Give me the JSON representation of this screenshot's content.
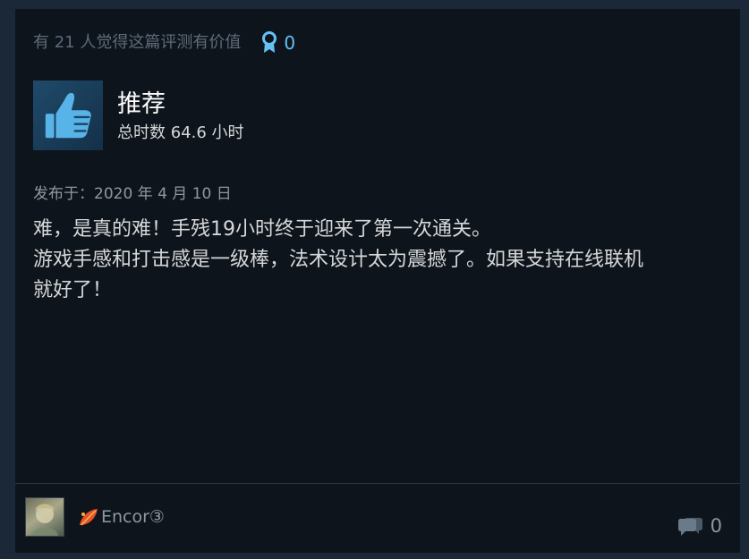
{
  "review": {
    "helpful_text": "有 21 人觉得这篇评测有价值",
    "award_count": "0",
    "recommendation": "推荐",
    "hours": "总时数 64.6 小时",
    "posted": "发布于：2020 年 4 月 10 日",
    "body_lines": [
      "难，是真的难！手残19小时终于迎来了第一次通关。",
      "游戏手感和打击感是一级棒，法术设计太为震撼了。如果支持在线联机",
      "就好了！"
    ]
  },
  "footer": {
    "author_name": "Encor③",
    "comment_count": "0"
  },
  "icons": {
    "award": "award-ribbon-icon",
    "thumb": "thumbs-up-icon",
    "leaf": "autumn-leaf-icon",
    "comment": "comment-bubbles-icon"
  },
  "colors": {
    "background": "#1b2838",
    "card": "#0d141c",
    "accent": "#66c0f4",
    "muted_text": "#8f98a0",
    "body_text": "#d6d7d8"
  }
}
